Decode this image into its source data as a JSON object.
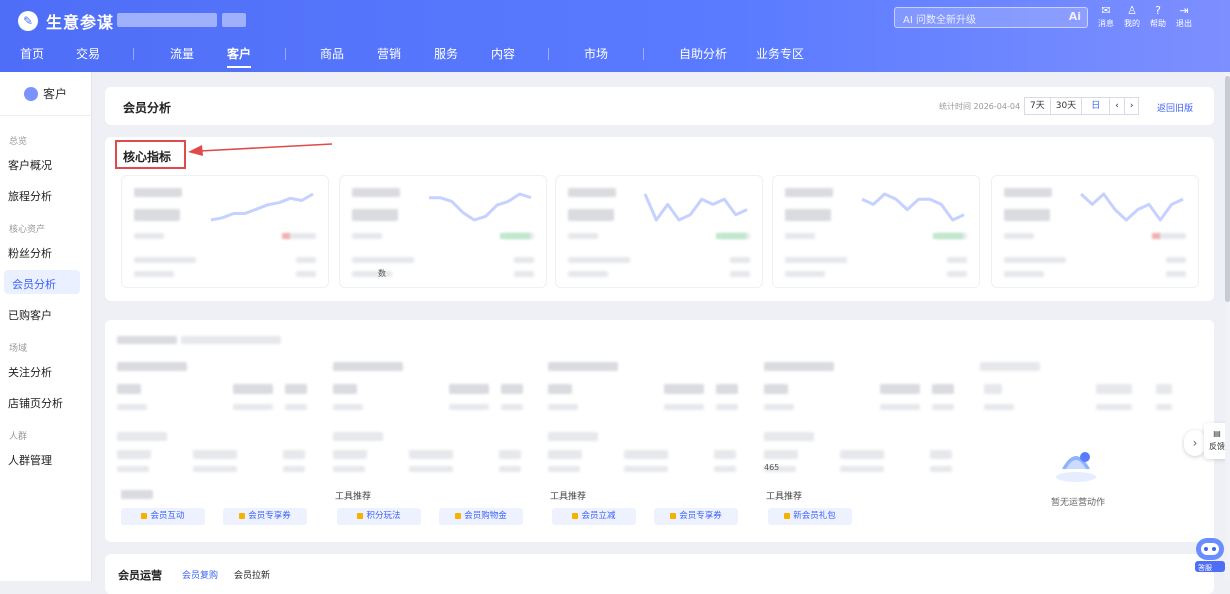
{
  "header": {
    "logo_text": "生意参谋",
    "ai_search_placeholder": "AI 问数全新升级",
    "top_icons": [
      {
        "icon": "mail-icon",
        "label": "消息"
      },
      {
        "icon": "user-icon",
        "label": "我的"
      },
      {
        "icon": "help-icon",
        "label": "帮助"
      },
      {
        "icon": "logout-icon",
        "label": "退出"
      }
    ],
    "nav": [
      "首页",
      "交易",
      "流量",
      "客户",
      "商品",
      "营销",
      "服务",
      "内容",
      "市场",
      "自助分析",
      "业务专区"
    ],
    "active_nav": "客户"
  },
  "sidebar": {
    "title": "客户",
    "groups": [
      {
        "label": "总览",
        "items": [
          "客户概况",
          "旅程分析"
        ]
      },
      {
        "label": "核心资产",
        "items": [
          "粉丝分析",
          "会员分析",
          "已购客户"
        ]
      },
      {
        "label": "场域",
        "items": [
          "关注分析",
          "店铺页分析"
        ]
      },
      {
        "label": "人群",
        "items": [
          "人群管理"
        ]
      }
    ],
    "active_item": "会员分析"
  },
  "page": {
    "title": "会员分析",
    "time_label": "统计时间 2026-04-04",
    "range_buttons": [
      "7天",
      "30天",
      "日"
    ],
    "back_link": "返回旧版",
    "core_title": "核心指标"
  },
  "metric_cards": [
    {
      "sub_text": "",
      "spark": [
        4,
        5,
        7,
        7,
        9,
        11,
        12,
        14,
        13,
        16
      ]
    },
    {
      "sub_text": "数",
      "spark": [
        12,
        12,
        11,
        8,
        6,
        7,
        10,
        11,
        13,
        12
      ]
    },
    {
      "sub_text": "",
      "spark": [
        13,
        8,
        11,
        8,
        9,
        12,
        11,
        12,
        9,
        10
      ]
    },
    {
      "sub_text": "",
      "spark": [
        12,
        11,
        13,
        12,
        10,
        12,
        12,
        11,
        8,
        9
      ]
    },
    {
      "sub_text": "",
      "spark": [
        13,
        11,
        13,
        10,
        8,
        10,
        11,
        8,
        11,
        12
      ]
    }
  ],
  "ops": {
    "tool_label": "工具推荐",
    "columns": [
      {
        "tools": [
          "会员互动",
          "会员专享券"
        ],
        "tag": ""
      },
      {
        "tools": [
          "积分玩法",
          "会员购物金"
        ],
        "tag": "工具推荐"
      },
      {
        "tools": [
          "会员立减",
          "会员专享券"
        ],
        "tag": "工具推荐"
      },
      {
        "tools": [
          "新会员礼包"
        ],
        "tag": "工具推荐",
        "value": "465"
      },
      {
        "tools": [],
        "tag": ""
      }
    ],
    "empty_text": "暂无运营动作"
  },
  "bottom": {
    "title": "会员运营",
    "tabs": [
      "会员复购",
      "会员拉新"
    ]
  },
  "widgets": {
    "feedback_label": "反馈",
    "robot_label": "答服"
  },
  "colors": {
    "brand": "#4f6ef7",
    "highlight": "#e04a4a",
    "link": "#3d63f7"
  }
}
